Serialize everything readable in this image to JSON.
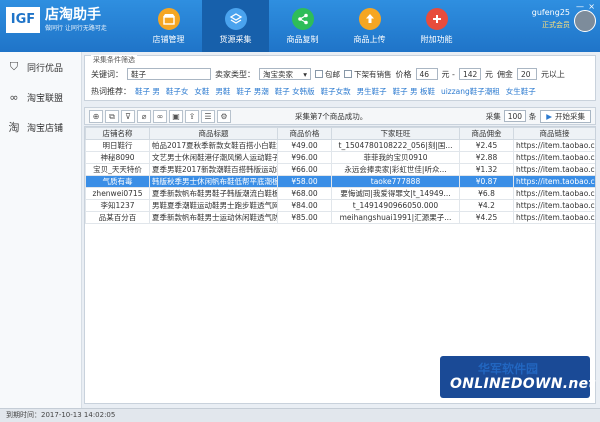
{
  "header": {
    "logo_mark": "IGF",
    "logo_title": "店淘助手",
    "logo_subtitle": "做同行 让同行无路可走",
    "nav": [
      {
        "label": "店铺管理",
        "icon": "store-icon",
        "color": "#f5a623"
      },
      {
        "label": "货源采集",
        "icon": "layers-icon",
        "color": "#4aa3ee"
      },
      {
        "label": "商品复制",
        "icon": "share-icon",
        "color": "#2ebd59"
      },
      {
        "label": "商品上传",
        "icon": "upload-icon",
        "color": "#f5a623"
      },
      {
        "label": "附加功能",
        "icon": "plus-icon",
        "color": "#e74c3c"
      }
    ],
    "user_name": "gufeng25",
    "user_status": "正式会员",
    "minimize": "—",
    "close": "×"
  },
  "sidebar": {
    "items": [
      {
        "label": "同行优品",
        "icon": "shield-icon",
        "glyph": "⛉"
      },
      {
        "label": "淘宝联盟",
        "icon": "infinity-icon",
        "glyph": "∞"
      },
      {
        "label": "淘宝店铺",
        "icon": "tao-icon",
        "glyph": "淘"
      }
    ]
  },
  "filter": {
    "legend": "采集条件筛选",
    "keyword_label": "关键词：",
    "keyword_value": "鞋子",
    "seller_type_label": "卖家类型：",
    "seller_type_value": "淘宝卖家",
    "free_shipping_label": "包邮",
    "no_goods_label": "下架有销售",
    "price_label": "价格",
    "price_min": "46",
    "price_sep": "元 -",
    "price_max": "142",
    "price_unit": "元",
    "commission_label": "佣金",
    "commission_value": "20",
    "commission_unit": "元以上",
    "hot_label": "热词推荐：",
    "hot_words": [
      "鞋子 男",
      "鞋子女",
      "女鞋",
      "男鞋",
      "鞋子 男潮",
      "鞋子 女韩版",
      "鞋子女款",
      "男生鞋子",
      "鞋子 男 板鞋",
      "uizzang鞋子潮租",
      "女生鞋子"
    ]
  },
  "toolbar": {
    "icons": [
      "globe-icon",
      "copy-icon",
      "filter-icon",
      "link-icon",
      "link2-icon",
      "save-icon",
      "export-icon",
      "settings-icon",
      "gear-icon"
    ],
    "glyphs": [
      "⊕",
      "⧉",
      "⊽",
      "⌀",
      "∞",
      "▣",
      "⇪",
      "☰",
      "⚙"
    ],
    "status": "采集第7个商品成功。",
    "collect_label": "采集",
    "collect_count": "100",
    "collect_unit": "条",
    "start_label": "开始采集"
  },
  "table": {
    "columns": [
      "店铺名称",
      "商品标题",
      "商品价格",
      "下家旺旺",
      "商品佣金",
      "商品链接"
    ],
    "rows": [
      [
        "明日鞋行",
        "帕品2017夏秋季新款女鞋百搭小白鞋女学生...",
        "¥49.00",
        "t_1504780108222_056|刻|国...",
        "¥2.45",
        "https://item.taobao.co..."
      ],
      [
        "神秘8090",
        "文艺男士休闲鞋港仔潮风懒人运动鞋子韩版...",
        "¥96.00",
        "菲菲我的宝贝0910",
        "¥2.88",
        "https://item.taobao.co..."
      ],
      [
        "宝贝_天天特价",
        "夏季男鞋2017新款潮鞋百搭韩版运动鞋男...",
        "¥66.00",
        "永远会捧卖家|彩虹世佳|听众...",
        "¥1.32",
        "https://item.taobao.co..."
      ],
      [
        "气质有毒",
        "韩版秋季男士休闲帆布鞋低帮平底潮板鞋透...",
        "¥58.00",
        "taoke777888",
        "¥0.87",
        "https://item.taobao.co..."
      ],
      [
        "zhenwei0715",
        "夏季新款帆布鞋男鞋子韩版潮流白鞋板...",
        "¥68.00",
        "要悔诚同|我爱得罪文|t_14949...",
        "¥6.8",
        "https://item.taobao.co..."
      ],
      [
        "李知1237",
        "男鞋夏季潮鞋运动鞋男士跑步鞋透气网面...",
        "¥84.00",
        "t_1491490966050.000",
        "¥4.2",
        "https://item.taobao.co..."
      ],
      [
        "品某百分百",
        "夏季新款帆布鞋男士运动休闲鞋透气防臭...",
        "¥85.00",
        "meihangshuai1991|汇源果子...",
        "¥4.25",
        "https://item.taobao.co..."
      ]
    ],
    "selected_row": 3
  },
  "statusbar": {
    "text": "到期时间：2017-10-13 14:02:05"
  },
  "watermark": {
    "cn": "华军软件园",
    "en": "ONLINEDOWN.net"
  }
}
